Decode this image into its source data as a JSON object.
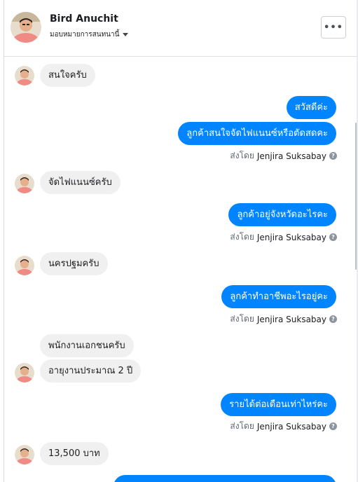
{
  "header": {
    "name": "Bird Anuchit",
    "subtitle": "มอบหมายการสนทนานี้",
    "more_label": "•••"
  },
  "icons": {
    "avatar": "avatar-profile-photo",
    "dropdown": "caret-down-icon",
    "more": "more-options-icon",
    "help": "question-circle-icon"
  },
  "colors": {
    "outgoing_bubble": "#0084ff",
    "incoming_bubble": "#f1f0f0"
  },
  "messages": [
    {
      "text": "สนใจครับ"
    },
    {
      "text": "สวัสดีค่ะ"
    },
    {
      "text": "ลูกค้าสนใจจัดไฟแนนซ์หรือตัดสดคะ"
    },
    {
      "text": "จัดไฟแนนซ์ครับ"
    },
    {
      "text": "ลูกค้าอยู่จังหวัดอะไรคะ"
    },
    {
      "text": "นครปฐมครับ"
    },
    {
      "text": "ลูกค้าทำอาชีพอะไรอยู่คะ"
    },
    {
      "text": "พนักงานเอกชนครับ"
    },
    {
      "text": "อายุงานประมาณ 2 ปี"
    },
    {
      "text": "รายได้ต่อเดือนเท่าไหร่คะ"
    },
    {
      "text": "13,500 บาท"
    }
  ],
  "sent_by": {
    "prefix": "ส่งโดย",
    "agent": "Jenjira Suksabay",
    "help": "?"
  }
}
